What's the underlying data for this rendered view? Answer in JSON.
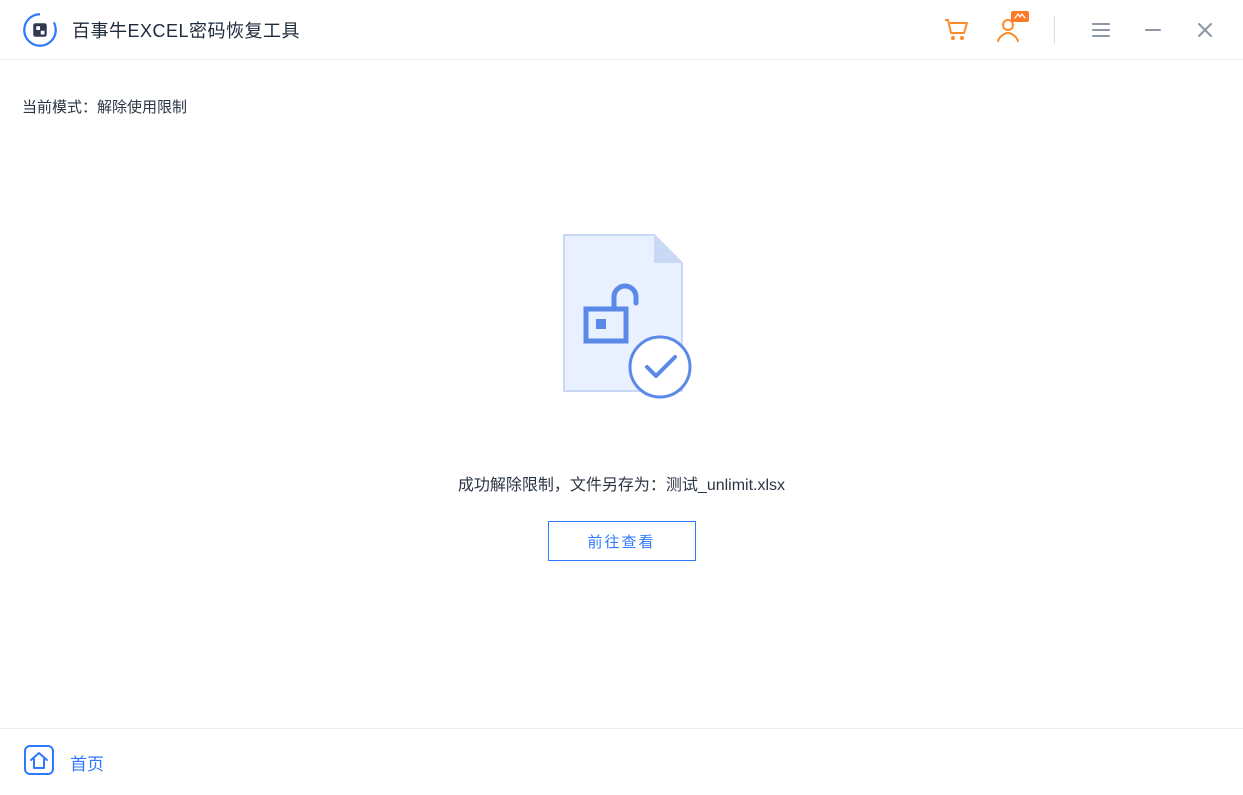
{
  "header": {
    "app_title": "百事牛EXCEL密码恢复工具"
  },
  "content": {
    "mode_label": "当前模式：",
    "mode_value": "解除使用限制",
    "success_message": "成功解除限制，文件另存为：测试_unlimit.xlsx",
    "action_button": "前往查看"
  },
  "footer": {
    "home_label": "首页"
  }
}
